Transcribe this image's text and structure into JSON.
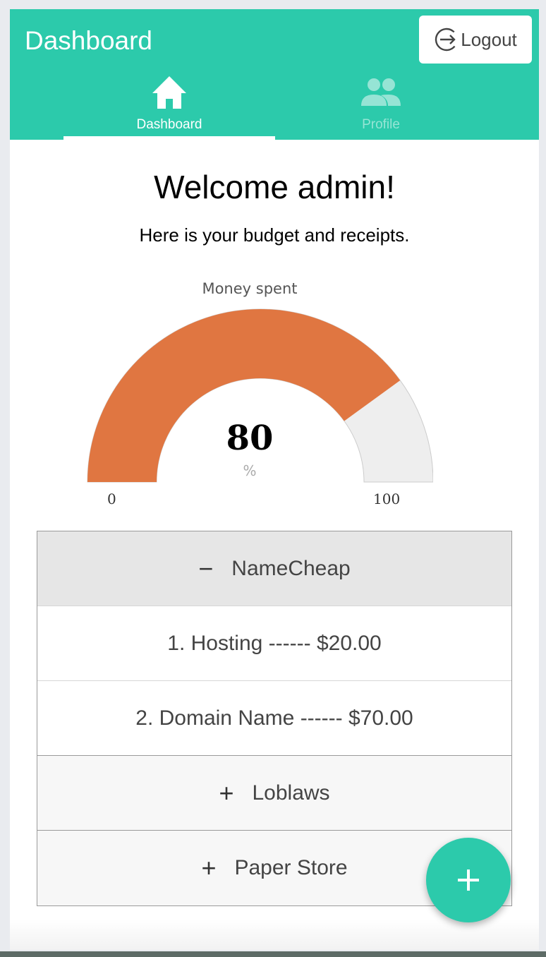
{
  "header": {
    "title": "Dashboard",
    "logout_label": "Logout",
    "tabs": [
      {
        "label": "Dashboard",
        "icon": "home-icon",
        "active": true
      },
      {
        "label": "Profile",
        "icon": "users-icon",
        "active": false
      }
    ]
  },
  "main": {
    "welcome": "Welcome admin!",
    "subtitle": "Here is your budget and receipts."
  },
  "gauge": {
    "title": "Money spent",
    "value": 80,
    "display_value": "80",
    "unit": "%",
    "min": 0,
    "max": 100,
    "min_label": "0",
    "max_label": "100",
    "fill_color": "#e07641",
    "track_color": "#eeeeee"
  },
  "accordion": {
    "sections": [
      {
        "name": "NameCheap",
        "sign": "−",
        "expanded": true,
        "items": [
          {
            "text": "1. Hosting ------ $20.00"
          },
          {
            "text": "2. Domain Name ------ $70.00"
          }
        ]
      },
      {
        "name": "Loblaws",
        "sign": "+",
        "expanded": false
      },
      {
        "name": "Paper Store",
        "sign": "+",
        "expanded": false
      }
    ]
  },
  "fab": {
    "icon": "plus-icon"
  },
  "colors": {
    "accent": "#2ccaab"
  }
}
